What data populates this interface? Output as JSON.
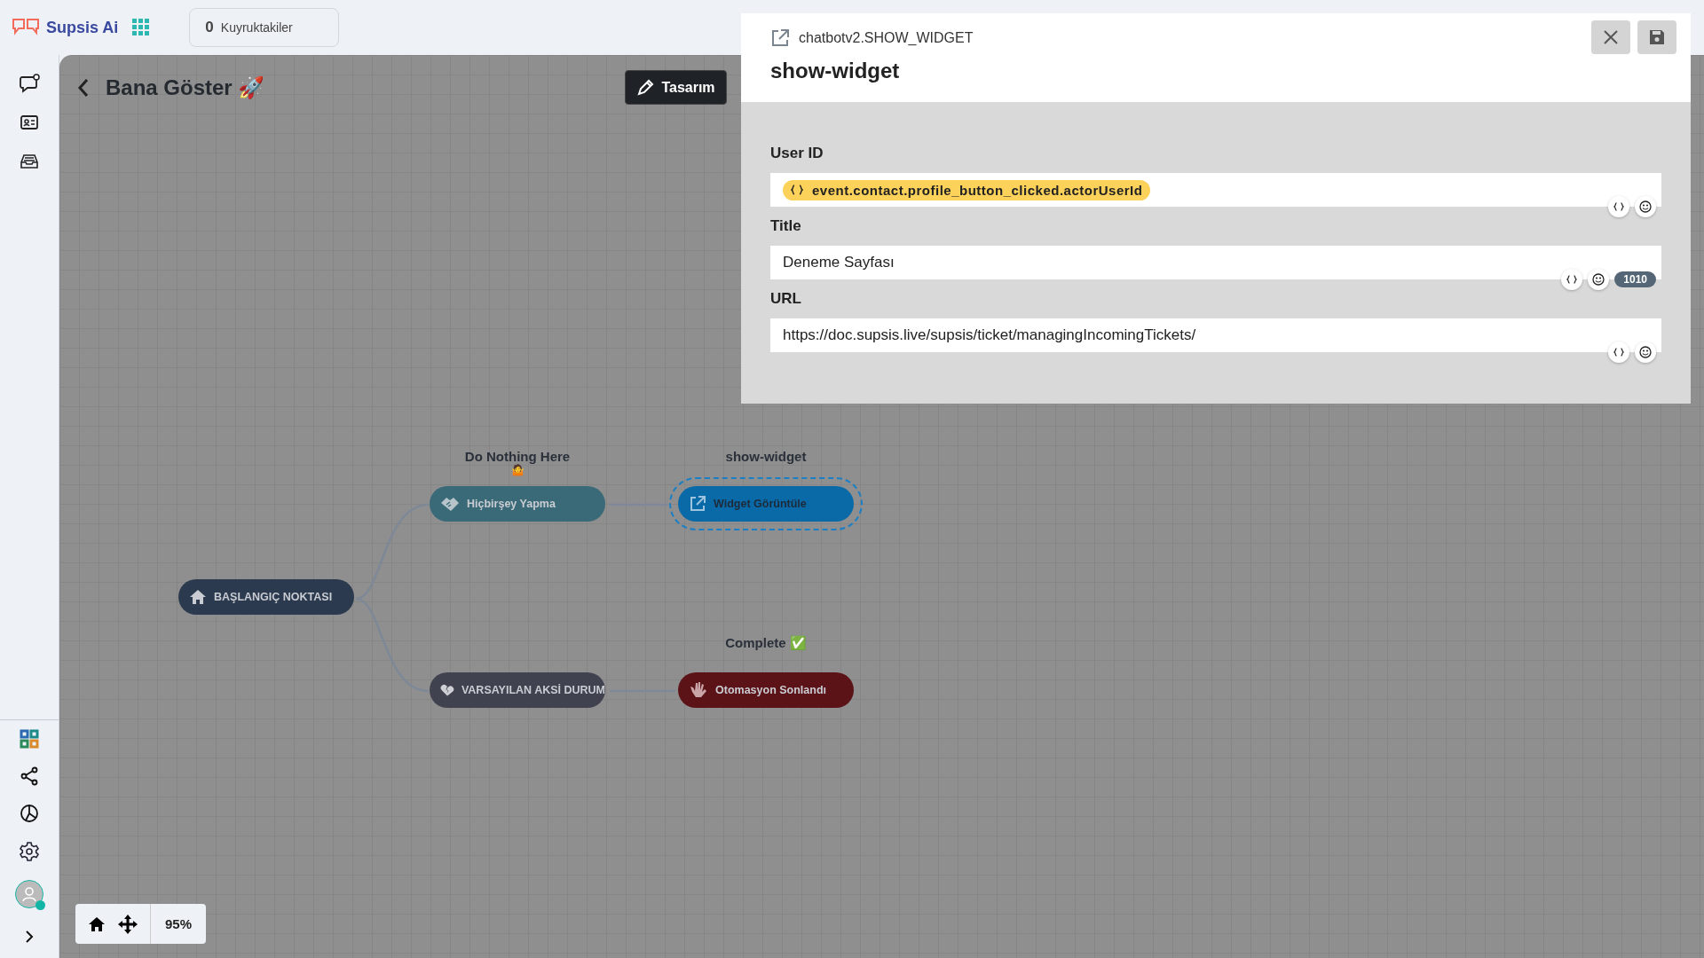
{
  "topbar": {
    "brand": "Supsis Ai",
    "queue": {
      "count": "0",
      "label": "Kuyruktakiler"
    }
  },
  "flow": {
    "title": "Bana Göster 🚀",
    "design_button": "Tasarım",
    "zoom": "95%",
    "nodes": [
      {
        "kind": "start",
        "label": "BAŞLANGIÇ NOKTASI",
        "color": "#2b3a4e",
        "selected": false
      },
      {
        "kind": "idle",
        "label": "Hiçbirşey Yapma",
        "caption": "Do Nothing Here",
        "emoji": "🤷",
        "color": "#3a6a78",
        "selected": false
      },
      {
        "kind": "widget",
        "label": "Widget Görüntüle",
        "caption": "show-widget",
        "color": "#0a6aa8",
        "selected": true
      },
      {
        "kind": "fallback",
        "label": "VARSAYILAN AKSİ DURUM",
        "color": "#40434f",
        "selected": false
      },
      {
        "kind": "end",
        "label": "Otomasyon Sonlandı",
        "caption": "Complete ✅",
        "color": "#5c1318",
        "selected": false
      }
    ]
  },
  "panel": {
    "type": "chatbotv2.SHOW_WIDGET",
    "title": "show-widget",
    "fields": [
      {
        "kind": "variable",
        "label": "User ID",
        "value": "event.contact.profile_button_clicked.actorUserId"
      },
      {
        "kind": "text",
        "label": "Title",
        "value": "Deneme Sayfası",
        "counter": "1010"
      },
      {
        "kind": "text",
        "label": "URL",
        "value": "https://doc.supsis.live/supsis/ticket/managingIncomingTickets/"
      }
    ]
  }
}
